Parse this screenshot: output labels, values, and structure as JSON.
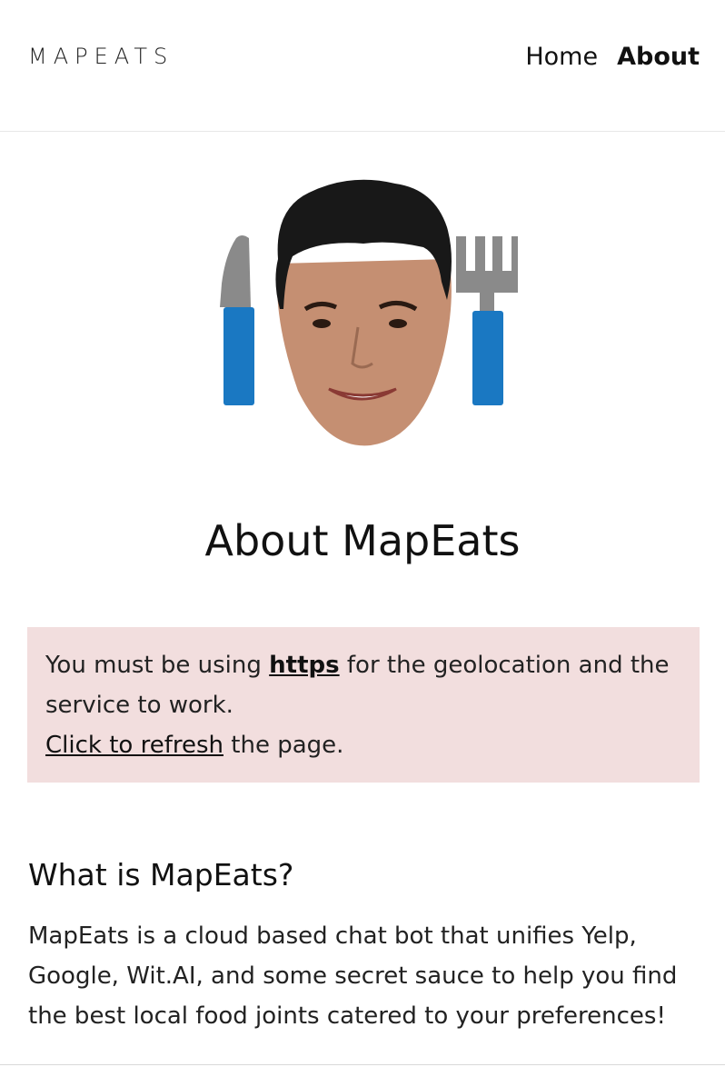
{
  "header": {
    "logo": "MAPEATS",
    "nav": [
      {
        "label": "Home",
        "active": false
      },
      {
        "label": "About",
        "active": true
      }
    ]
  },
  "hero": {
    "icon": "face-with-knife-and-fork-logo",
    "colors": {
      "utensil_blade": "#8a8a8a",
      "utensil_handle": "#1a78c2"
    }
  },
  "main": {
    "title": "About MapEats",
    "alert": {
      "text_before": "You must be using ",
      "https_link": "https",
      "text_after": " for the geolocation and the service to work.",
      "refresh_link": "Click to refresh",
      "refresh_after": " the page.",
      "background": "#f2dede"
    },
    "section": {
      "heading": "What is MapEats?",
      "body": "MapEats is a cloud based chat bot that unifies Yelp, Google, Wit.AI, and some secret sauce to help you find the best local food joints catered to your preferences!"
    }
  }
}
